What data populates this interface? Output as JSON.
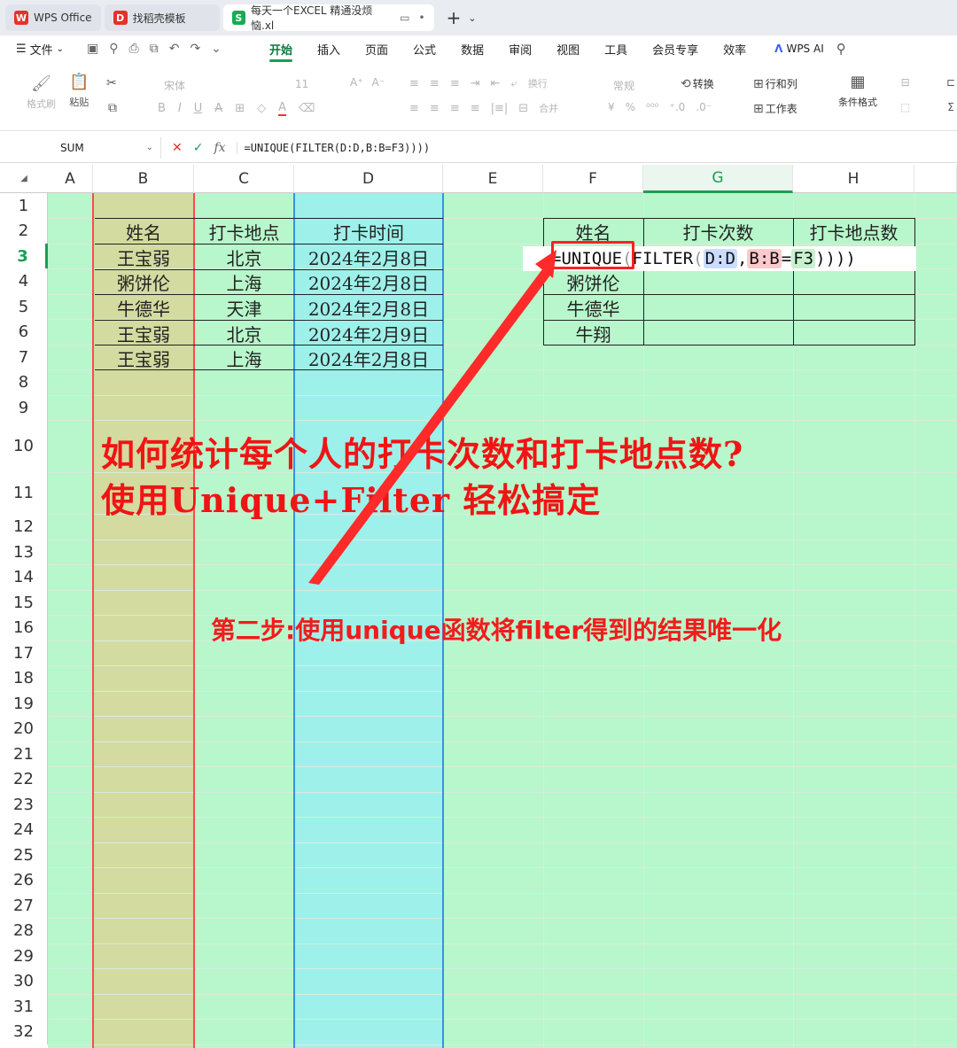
{
  "tabs": [
    {
      "label": "WPS Office",
      "logo": "W",
      "logo_color": "#e8302b"
    },
    {
      "label": "找稻壳模板",
      "logo": "D",
      "logo_color": "#e8302b"
    },
    {
      "label": "每天一个EXCEL 精通没烦恼.xl",
      "logo": "S",
      "logo_color": "#1aaa55",
      "active": true
    }
  ],
  "menubar": {
    "file": "文件",
    "items": [
      "开始",
      "插入",
      "页面",
      "公式",
      "数据",
      "审阅",
      "视图",
      "工具",
      "会员专享",
      "效率"
    ],
    "active": "开始",
    "ai": "WPS AI"
  },
  "ribbon": {
    "format_painter": "格式刷",
    "paste": "粘贴",
    "font_name": "宋体",
    "font_size": "11",
    "wrap": "换行",
    "merge": "合并",
    "number_format": "常规",
    "convert": "转换",
    "rows_cols": "行和列",
    "worksheet": "工作表",
    "cond_format": "条件格式"
  },
  "formula_bar": {
    "name_box": "SUM",
    "formula": "=UNIQUE(FILTER(D:D,B:B=F3))))"
  },
  "columns": [
    "A",
    "B",
    "C",
    "D",
    "E",
    "F",
    "G",
    "H"
  ],
  "selected_column": "G",
  "rows": [
    "1",
    "2",
    "3",
    "4",
    "5",
    "6",
    "7",
    "8",
    "9",
    "10",
    "11",
    "12",
    "13",
    "14",
    "15",
    "16",
    "17",
    "18",
    "19",
    "20",
    "21",
    "22",
    "23",
    "24",
    "25",
    "26",
    "27",
    "28",
    "29",
    "30",
    "31",
    "32"
  ],
  "selected_row": "3",
  "left_table": {
    "headers": [
      "姓名",
      "打卡地点",
      "打卡时间"
    ],
    "rows": [
      [
        "王宝弱",
        "北京",
        "2024年2月8日"
      ],
      [
        "粥饼伦",
        "上海",
        "2024年2月8日"
      ],
      [
        "牛德华",
        "天津",
        "2024年2月8日"
      ],
      [
        "王宝弱",
        "北京",
        "2024年2月9日"
      ],
      [
        "王宝弱",
        "上海",
        "2024年2月8日"
      ]
    ]
  },
  "right_table": {
    "headers": [
      "姓名",
      "打卡次数",
      "打卡地点数"
    ],
    "names": [
      "粥饼伦",
      "牛德华",
      "牛翔"
    ]
  },
  "formula_cell": {
    "p1": "=UNIQUE",
    "p2": "(",
    "p3": "FILTER",
    "p4": "(",
    "p5": "D:D",
    "p6": ",",
    "p7": "B:B",
    "p8": "=",
    "p9": "F3",
    "p10": "))))"
  },
  "annotations": {
    "headline_1": "如何统计每个人的打卡次数和打卡地点数?",
    "headline_2": "使用Unique+Filter 轻松搞定",
    "step": "第二步:使用unique函数将filter得到的结果唯一化",
    "color": "#f01414"
  }
}
